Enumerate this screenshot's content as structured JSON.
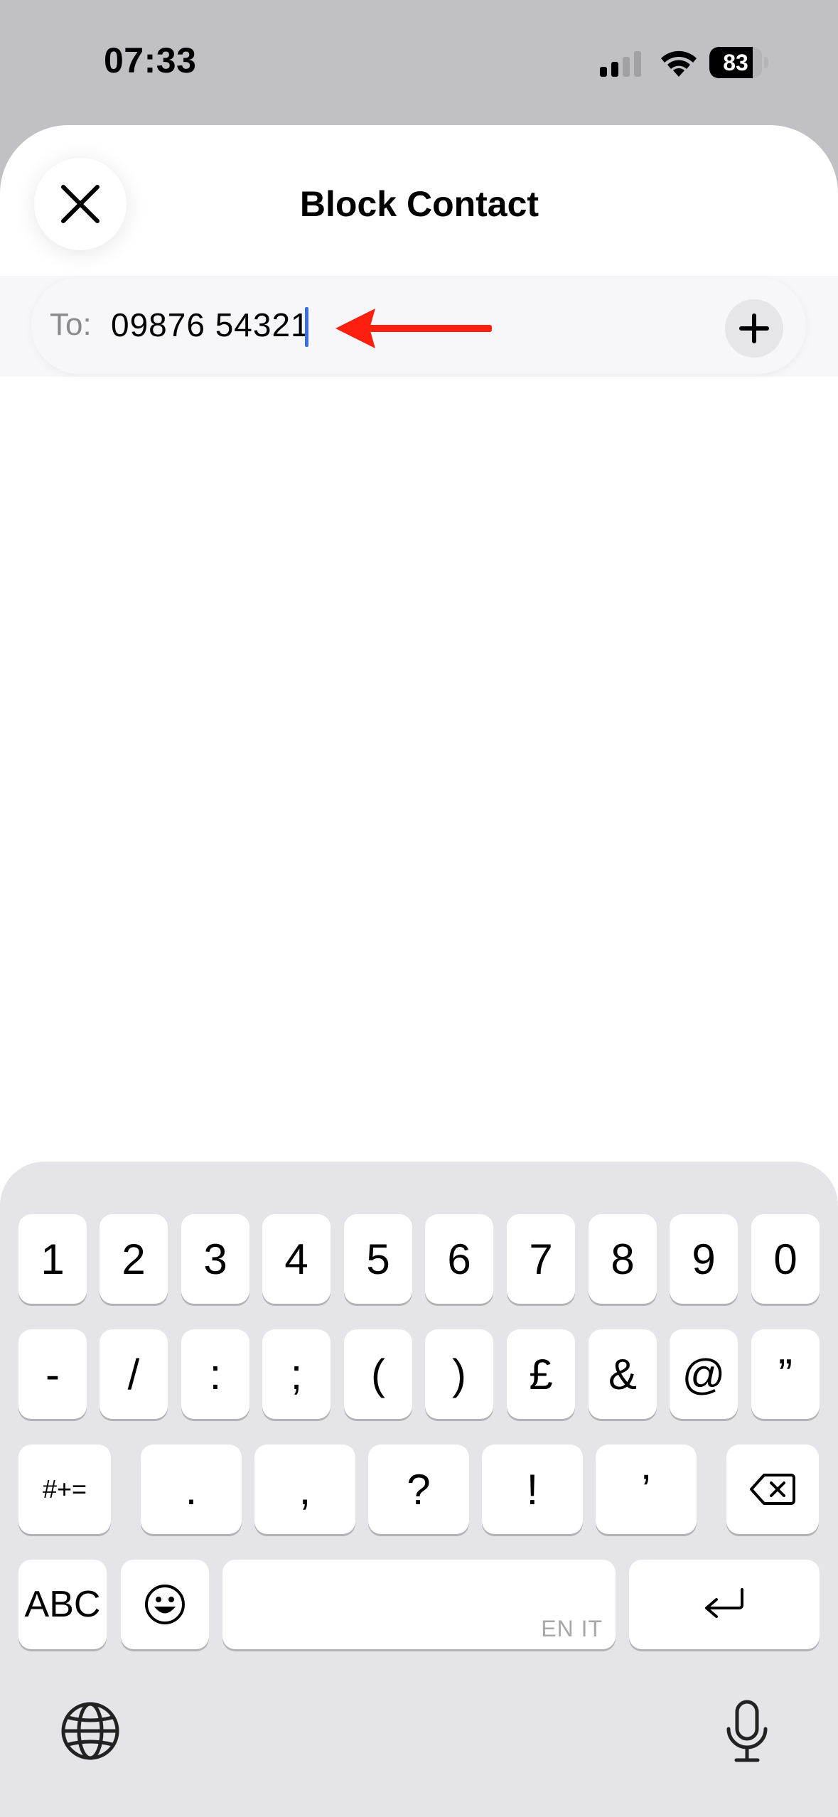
{
  "status_bar": {
    "time": "07:33",
    "battery_level": "83",
    "battery_fraction": 0.83,
    "icons": [
      "signal-icon",
      "wifi-icon",
      "battery-icon"
    ]
  },
  "sheet": {
    "title": "Block Contact",
    "close_icon": "close-icon",
    "to_label": "To:",
    "to_value": "09876 54321",
    "add_icon": "plus-icon",
    "annotation_arrow_color": "#ff1f0f"
  },
  "keyboard": {
    "row1": [
      "1",
      "2",
      "3",
      "4",
      "5",
      "6",
      "7",
      "8",
      "9",
      "0"
    ],
    "row2": [
      "-",
      "/",
      ":",
      ";",
      "(",
      ")",
      "£",
      "&",
      "@",
      "”"
    ],
    "row3_toggle": "#+=",
    "row3": [
      ".",
      ",",
      "?",
      "!",
      "’"
    ],
    "abc_label": "ABC",
    "space_hint": "EN IT",
    "icons": [
      "delete-icon",
      "emoji-icon",
      "return-icon",
      "globe-icon",
      "microphone-icon"
    ],
    "colors": {
      "background": "#e4e4e9",
      "key": "#ffffff"
    }
  }
}
